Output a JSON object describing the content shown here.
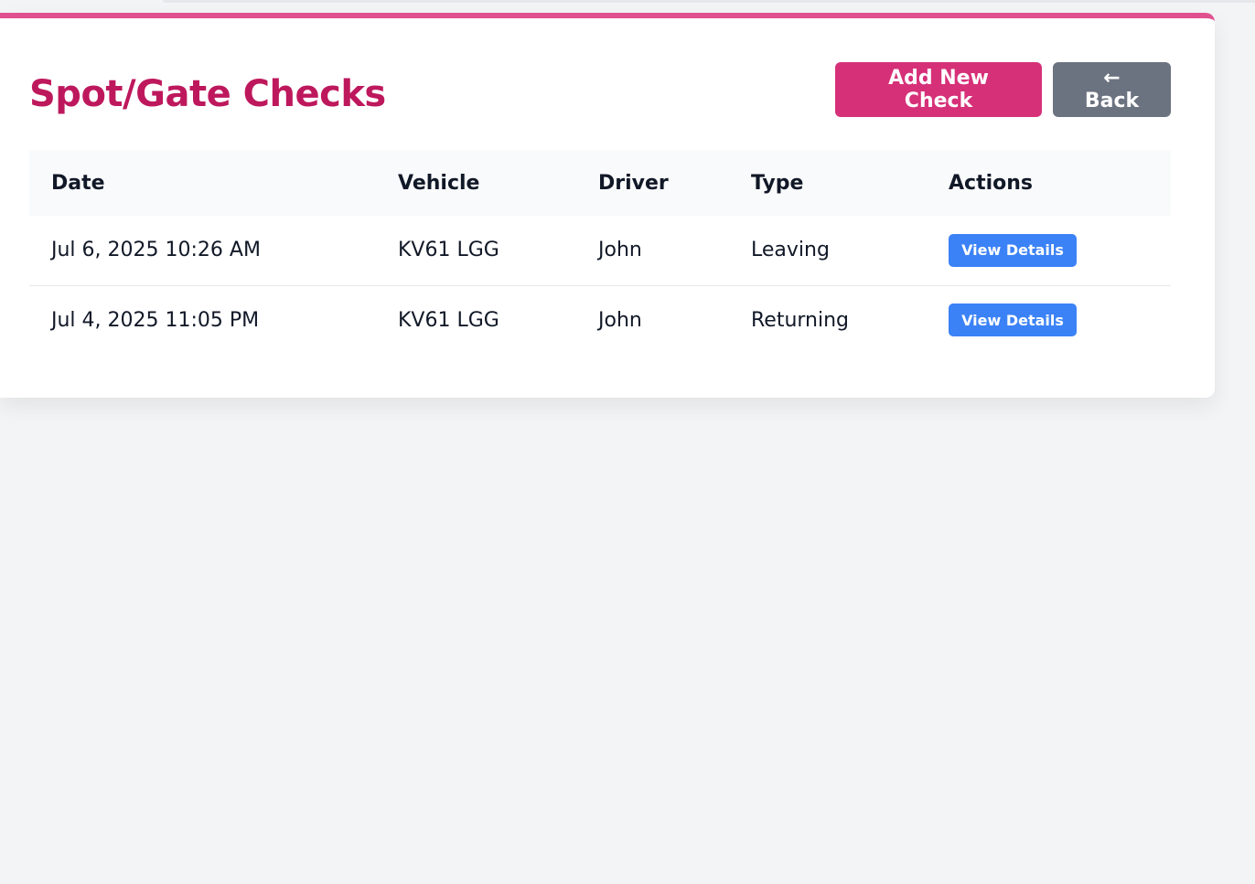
{
  "page": {
    "title": "Spot/Gate Checks",
    "accent_color": "#e0508f",
    "title_color": "#be185d"
  },
  "toolbar": {
    "add_label": "Add New Check",
    "add_color": "#d63078",
    "back_label": "← Back",
    "back_color": "#6b7280"
  },
  "table": {
    "headers": [
      "Date",
      "Vehicle",
      "Driver",
      "Type",
      "Actions"
    ],
    "rows": [
      {
        "date": "Jul 6, 2025 10:26 AM",
        "vehicle": "KV61 LGG",
        "driver": "John",
        "type": "Leaving",
        "action": "View Details"
      },
      {
        "date": "Jul 4, 2025 11:05 PM",
        "vehicle": "KV61 LGG",
        "driver": "John",
        "type": "Returning",
        "action": "View Details"
      }
    ],
    "action_color": "#3b82f6"
  }
}
